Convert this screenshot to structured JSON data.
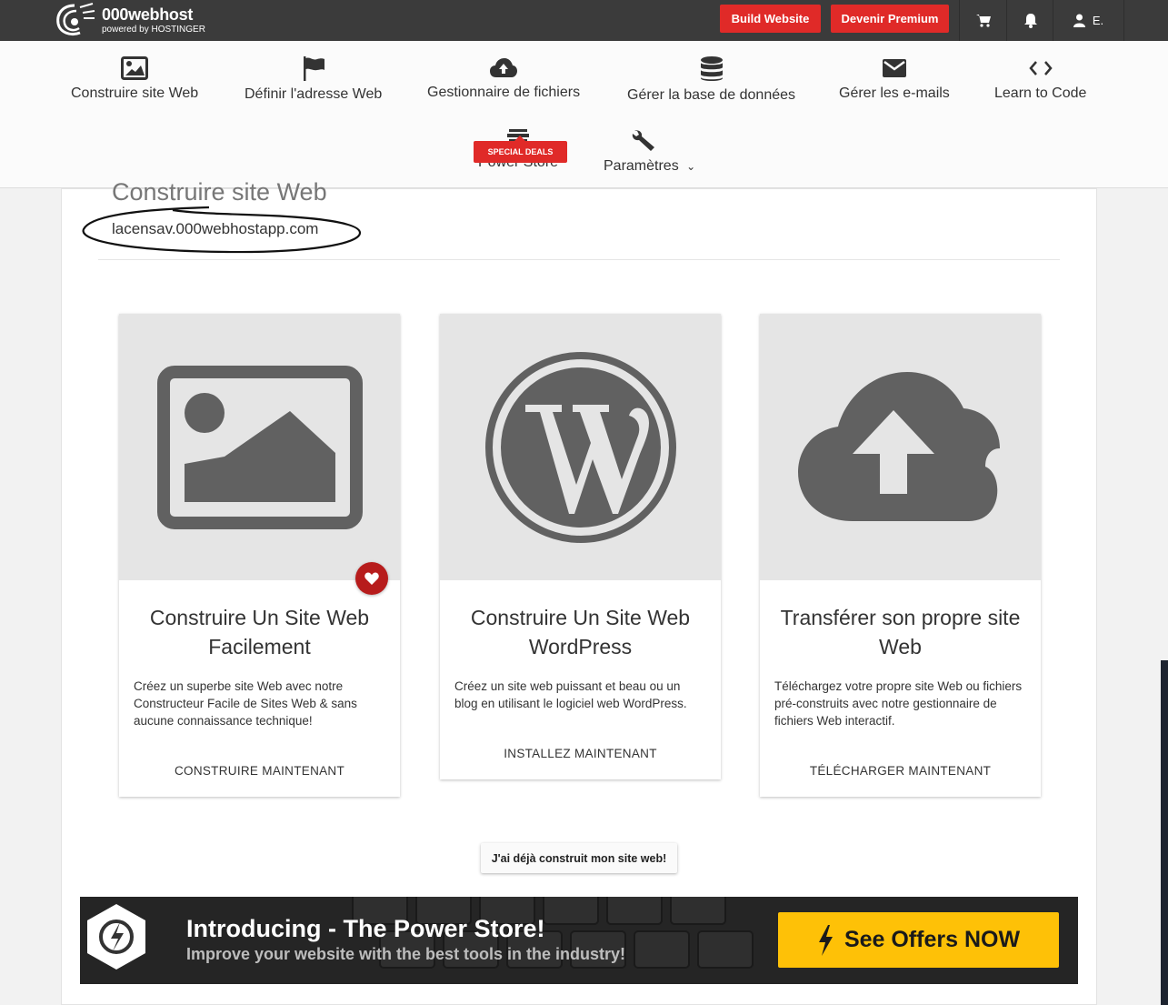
{
  "topbar": {
    "brand": "000webhost",
    "brand_sub": "powered by HOSTINGER",
    "build_website": "Build Website",
    "premium": "Devenir Premium",
    "user": "E.",
    "icons": [
      "cart-icon",
      "bell-icon",
      "user-icon"
    ]
  },
  "nav": {
    "items": [
      {
        "label": "Construire site Web",
        "icon": "image-icon"
      },
      {
        "label": "Définir l'adresse Web",
        "icon": "flag-icon"
      },
      {
        "label": "Gestionnaire de fichiers",
        "icon": "cloud-upload-icon"
      },
      {
        "label": "Gérer la base de données",
        "icon": "database-icon"
      },
      {
        "label": "Gérer les e-mails",
        "icon": "envelope-icon"
      },
      {
        "label": "Learn to Code",
        "icon": "code-icon"
      },
      {
        "label": "Power Store",
        "icon": "store-icon",
        "badge": "SPECIAL DEALS"
      },
      {
        "label": "Paramètres",
        "icon": "wrench-icon",
        "caret": "⌄"
      }
    ]
  },
  "page": {
    "title": "Construire site Web",
    "domain": "lacensav.000webhostapp.com"
  },
  "cards": [
    {
      "title": "Construire Un Site Web Facilement",
      "desc": "Créez un superbe site Web avec notre Constructeur Facile de Sites Web & sans aucune connaissance technique!",
      "action": "CONSTRUIRE MAINTENANT",
      "icon": "image-icon",
      "favorite": true
    },
    {
      "title": "Construire Un Site Web WordPress",
      "desc": "Créez un site web puissant et beau ou un blog en utilisant le logiciel web WordPress.",
      "action": "INSTALLEZ MAINTENANT",
      "icon": "wordpress-icon"
    },
    {
      "title": "Transférer son propre site Web",
      "desc": "Téléchargez votre propre site Web ou fichiers pré-construits avec notre gestionnaire de fichiers Web interactif.",
      "action": "TÉLÉCHARGER MAINTENANT",
      "icon": "cloud-upload-icon"
    }
  ],
  "already_built": "J'ai déjà construit mon site web!",
  "banner": {
    "title": "Introducing - The Power Store!",
    "subtitle": "Improve your website with the best tools in the industry!",
    "cta": "See Offers NOW"
  },
  "colors": {
    "topbar": "#3b3b3b",
    "accent_red": "#e02a28",
    "icon_gray": "#616161",
    "card_img_bg": "#e5e5e5",
    "cta_yellow": "#fec107"
  }
}
